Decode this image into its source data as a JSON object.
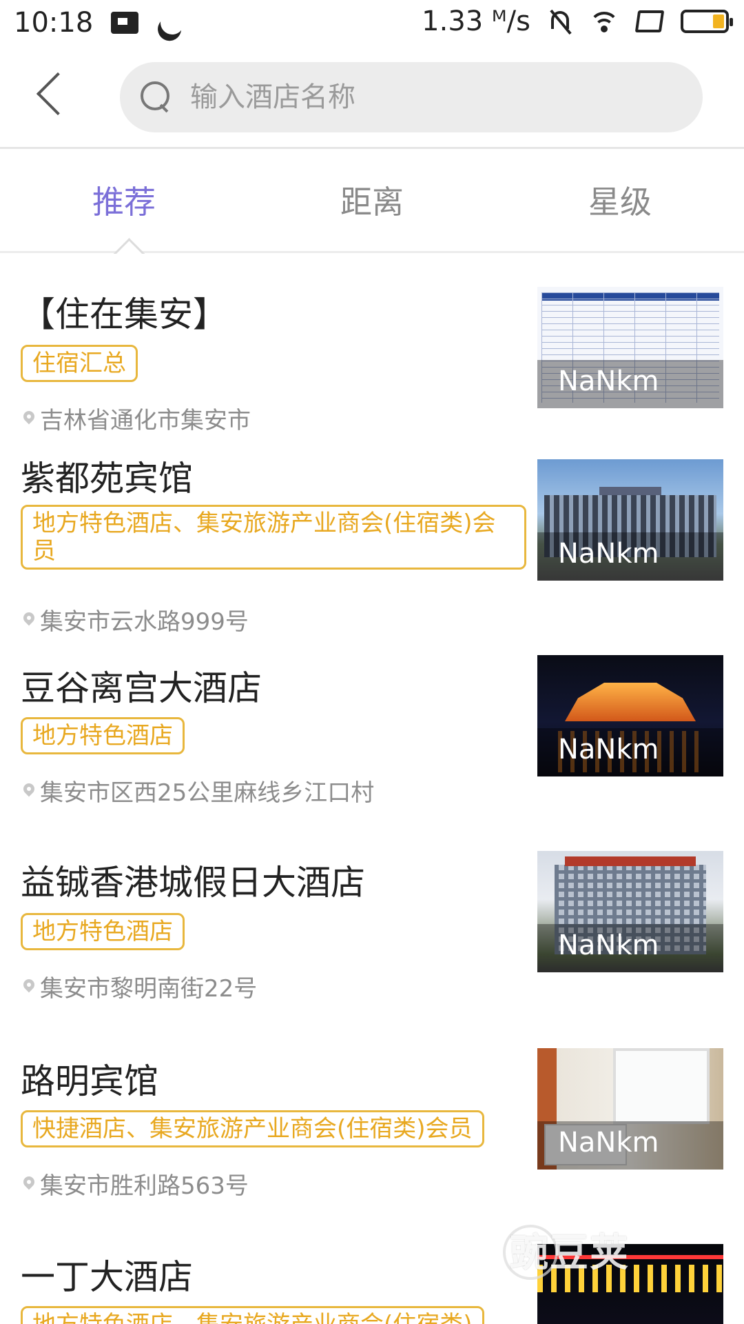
{
  "status_bar": {
    "time": "10:18",
    "network_speed": "1.33 ᴹ/s",
    "battery_color": "#f2b320"
  },
  "header": {
    "back_icon": "chevron-left-icon",
    "search": {
      "placeholder": "输入酒店名称",
      "value": "",
      "icon": "search-icon"
    }
  },
  "tabs": [
    {
      "label": "推荐",
      "active": true
    },
    {
      "label": "距离",
      "active": false
    },
    {
      "label": "星级",
      "active": false
    }
  ],
  "accent_color": "#7b6fd8",
  "tag_color": "#e8a820",
  "hotels": [
    {
      "name": "【住在集安】",
      "tag": "住宿汇总",
      "address": "吉林省通化市集安市",
      "distance": "NaNkm"
    },
    {
      "name": "紫都苑宾馆",
      "tag": "地方特色酒店、集安旅游产业商会(住宿类)会员",
      "address": "集安市云水路999号",
      "distance": "NaNkm"
    },
    {
      "name": "豆谷离宫大酒店",
      "tag": "地方特色酒店",
      "address": "集安市区西25公里麻线乡江口村",
      "distance": "NaNkm"
    },
    {
      "name": "益铖香港城假日大酒店",
      "tag": "地方特色酒店",
      "address": "集安市黎明南街22号",
      "distance": "NaNkm"
    },
    {
      "name": "路明宾馆",
      "tag": "快捷酒店、集安旅游产业商会(住宿类)会员",
      "address": "集安市胜利路563号",
      "distance": "NaNkm"
    },
    {
      "name": "一丁大酒店",
      "tag": "地方特色酒店、集安旅游产业商会(住宿类)",
      "address": "",
      "distance": ""
    }
  ],
  "watermark": "豌豆荚"
}
